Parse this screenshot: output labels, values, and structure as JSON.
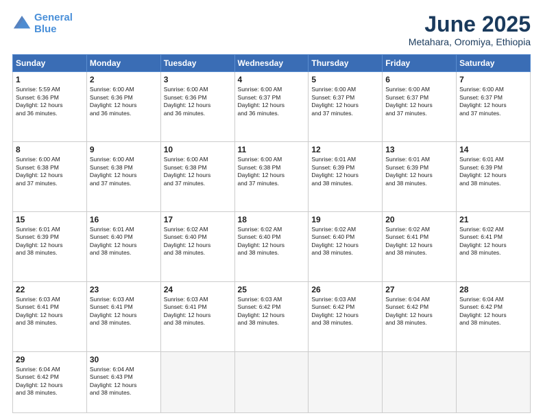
{
  "logo": {
    "line1": "General",
    "line2": "Blue"
  },
  "title": "June 2025",
  "subtitle": "Metahara, Oromiya, Ethiopia",
  "weekdays": [
    "Sunday",
    "Monday",
    "Tuesday",
    "Wednesday",
    "Thursday",
    "Friday",
    "Saturday"
  ],
  "weeks": [
    [
      {
        "day": "1",
        "info": "Sunrise: 5:59 AM\nSunset: 6:36 PM\nDaylight: 12 hours\nand 36 minutes."
      },
      {
        "day": "2",
        "info": "Sunrise: 6:00 AM\nSunset: 6:36 PM\nDaylight: 12 hours\nand 36 minutes."
      },
      {
        "day": "3",
        "info": "Sunrise: 6:00 AM\nSunset: 6:36 PM\nDaylight: 12 hours\nand 36 minutes."
      },
      {
        "day": "4",
        "info": "Sunrise: 6:00 AM\nSunset: 6:37 PM\nDaylight: 12 hours\nand 36 minutes."
      },
      {
        "day": "5",
        "info": "Sunrise: 6:00 AM\nSunset: 6:37 PM\nDaylight: 12 hours\nand 37 minutes."
      },
      {
        "day": "6",
        "info": "Sunrise: 6:00 AM\nSunset: 6:37 PM\nDaylight: 12 hours\nand 37 minutes."
      },
      {
        "day": "7",
        "info": "Sunrise: 6:00 AM\nSunset: 6:37 PM\nDaylight: 12 hours\nand 37 minutes."
      }
    ],
    [
      {
        "day": "8",
        "info": "Sunrise: 6:00 AM\nSunset: 6:38 PM\nDaylight: 12 hours\nand 37 minutes."
      },
      {
        "day": "9",
        "info": "Sunrise: 6:00 AM\nSunset: 6:38 PM\nDaylight: 12 hours\nand 37 minutes."
      },
      {
        "day": "10",
        "info": "Sunrise: 6:00 AM\nSunset: 6:38 PM\nDaylight: 12 hours\nand 37 minutes."
      },
      {
        "day": "11",
        "info": "Sunrise: 6:00 AM\nSunset: 6:38 PM\nDaylight: 12 hours\nand 37 minutes."
      },
      {
        "day": "12",
        "info": "Sunrise: 6:01 AM\nSunset: 6:39 PM\nDaylight: 12 hours\nand 38 minutes."
      },
      {
        "day": "13",
        "info": "Sunrise: 6:01 AM\nSunset: 6:39 PM\nDaylight: 12 hours\nand 38 minutes."
      },
      {
        "day": "14",
        "info": "Sunrise: 6:01 AM\nSunset: 6:39 PM\nDaylight: 12 hours\nand 38 minutes."
      }
    ],
    [
      {
        "day": "15",
        "info": "Sunrise: 6:01 AM\nSunset: 6:39 PM\nDaylight: 12 hours\nand 38 minutes."
      },
      {
        "day": "16",
        "info": "Sunrise: 6:01 AM\nSunset: 6:40 PM\nDaylight: 12 hours\nand 38 minutes."
      },
      {
        "day": "17",
        "info": "Sunrise: 6:02 AM\nSunset: 6:40 PM\nDaylight: 12 hours\nand 38 minutes."
      },
      {
        "day": "18",
        "info": "Sunrise: 6:02 AM\nSunset: 6:40 PM\nDaylight: 12 hours\nand 38 minutes."
      },
      {
        "day": "19",
        "info": "Sunrise: 6:02 AM\nSunset: 6:40 PM\nDaylight: 12 hours\nand 38 minutes."
      },
      {
        "day": "20",
        "info": "Sunrise: 6:02 AM\nSunset: 6:41 PM\nDaylight: 12 hours\nand 38 minutes."
      },
      {
        "day": "21",
        "info": "Sunrise: 6:02 AM\nSunset: 6:41 PM\nDaylight: 12 hours\nand 38 minutes."
      }
    ],
    [
      {
        "day": "22",
        "info": "Sunrise: 6:03 AM\nSunset: 6:41 PM\nDaylight: 12 hours\nand 38 minutes."
      },
      {
        "day": "23",
        "info": "Sunrise: 6:03 AM\nSunset: 6:41 PM\nDaylight: 12 hours\nand 38 minutes."
      },
      {
        "day": "24",
        "info": "Sunrise: 6:03 AM\nSunset: 6:41 PM\nDaylight: 12 hours\nand 38 minutes."
      },
      {
        "day": "25",
        "info": "Sunrise: 6:03 AM\nSunset: 6:42 PM\nDaylight: 12 hours\nand 38 minutes."
      },
      {
        "day": "26",
        "info": "Sunrise: 6:03 AM\nSunset: 6:42 PM\nDaylight: 12 hours\nand 38 minutes."
      },
      {
        "day": "27",
        "info": "Sunrise: 6:04 AM\nSunset: 6:42 PM\nDaylight: 12 hours\nand 38 minutes."
      },
      {
        "day": "28",
        "info": "Sunrise: 6:04 AM\nSunset: 6:42 PM\nDaylight: 12 hours\nand 38 minutes."
      }
    ],
    [
      {
        "day": "29",
        "info": "Sunrise: 6:04 AM\nSunset: 6:42 PM\nDaylight: 12 hours\nand 38 minutes."
      },
      {
        "day": "30",
        "info": "Sunrise: 6:04 AM\nSunset: 6:43 PM\nDaylight: 12 hours\nand 38 minutes."
      },
      {
        "day": "",
        "info": ""
      },
      {
        "day": "",
        "info": ""
      },
      {
        "day": "",
        "info": ""
      },
      {
        "day": "",
        "info": ""
      },
      {
        "day": "",
        "info": ""
      }
    ]
  ]
}
